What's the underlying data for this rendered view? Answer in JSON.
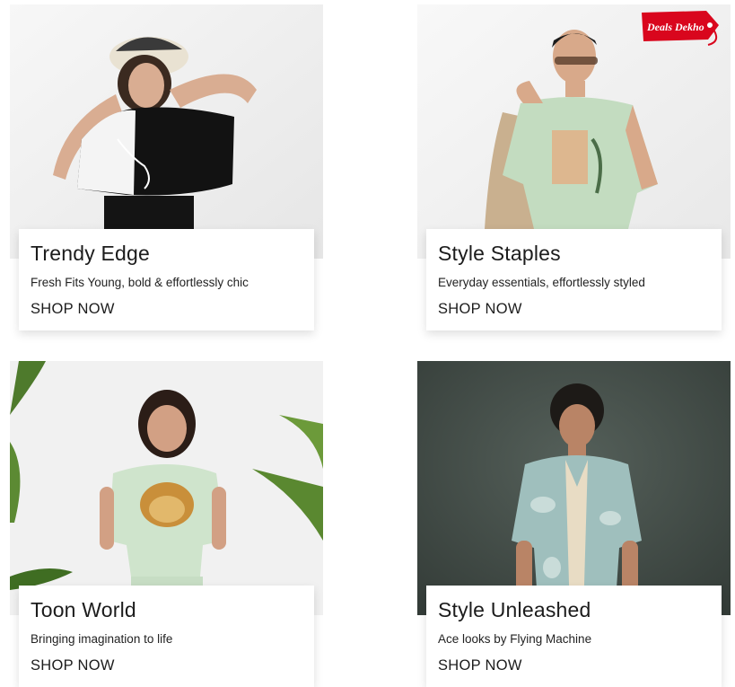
{
  "tiles": [
    {
      "title": "Trendy Edge",
      "subtitle": "Fresh Fits Young, bold & effortlessly chic",
      "cta": "SHOP NOW"
    },
    {
      "title": "Style Staples",
      "subtitle": "Everyday essentials, effortlessly styled",
      "cta": "SHOP NOW"
    },
    {
      "title": "Toon World",
      "subtitle": "Bringing imagination to life",
      "cta": "SHOP NOW"
    },
    {
      "title": "Style Unleashed",
      "subtitle": "Ace looks by Flying Machine",
      "cta": "SHOP NOW"
    }
  ],
  "badge": {
    "label": "Deals Dekho",
    "color": "#d9061d"
  },
  "colors": {
    "accent": "#d9061d",
    "text": "#1c1c1c",
    "dark_bg": "#3c4641"
  }
}
